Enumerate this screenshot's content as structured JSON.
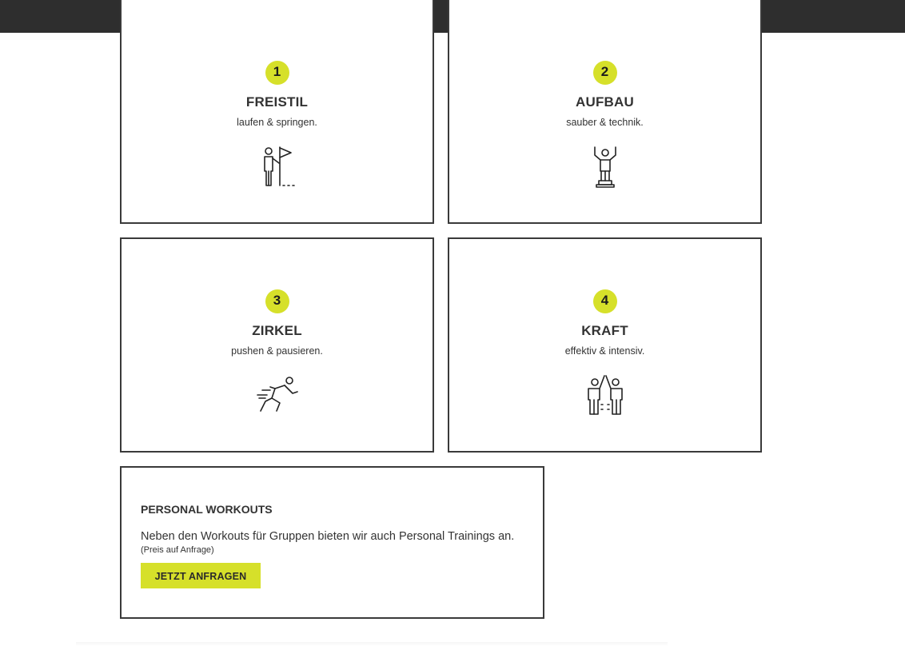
{
  "colors": {
    "accent": "#d6e02a",
    "topbar": "#2e2e2e",
    "border": "#3a3a3a",
    "text": "#333333"
  },
  "cards": [
    {
      "number": "1",
      "title": "FREISTIL",
      "subtitle": "laufen & springen.",
      "icon": "person-with-flag-icon"
    },
    {
      "number": "2",
      "title": "AUFBAU",
      "subtitle": "sauber & technik.",
      "icon": "person-on-podium-icon"
    },
    {
      "number": "3",
      "title": "ZIRKEL",
      "subtitle": "pushen & pausieren.",
      "icon": "sprinter-icon"
    },
    {
      "number": "4",
      "title": "KRAFT",
      "subtitle": "effektiv & intensiv.",
      "icon": "high-five-icon"
    }
  ],
  "promo": {
    "title": "PERSONAL WORKOUTS",
    "text": "Neben den Workouts für Gruppen bieten wir auch Personal Trainings an.",
    "note": "(Preis auf Anfrage)",
    "button_label": "JETZT ANFRAGEN"
  }
}
